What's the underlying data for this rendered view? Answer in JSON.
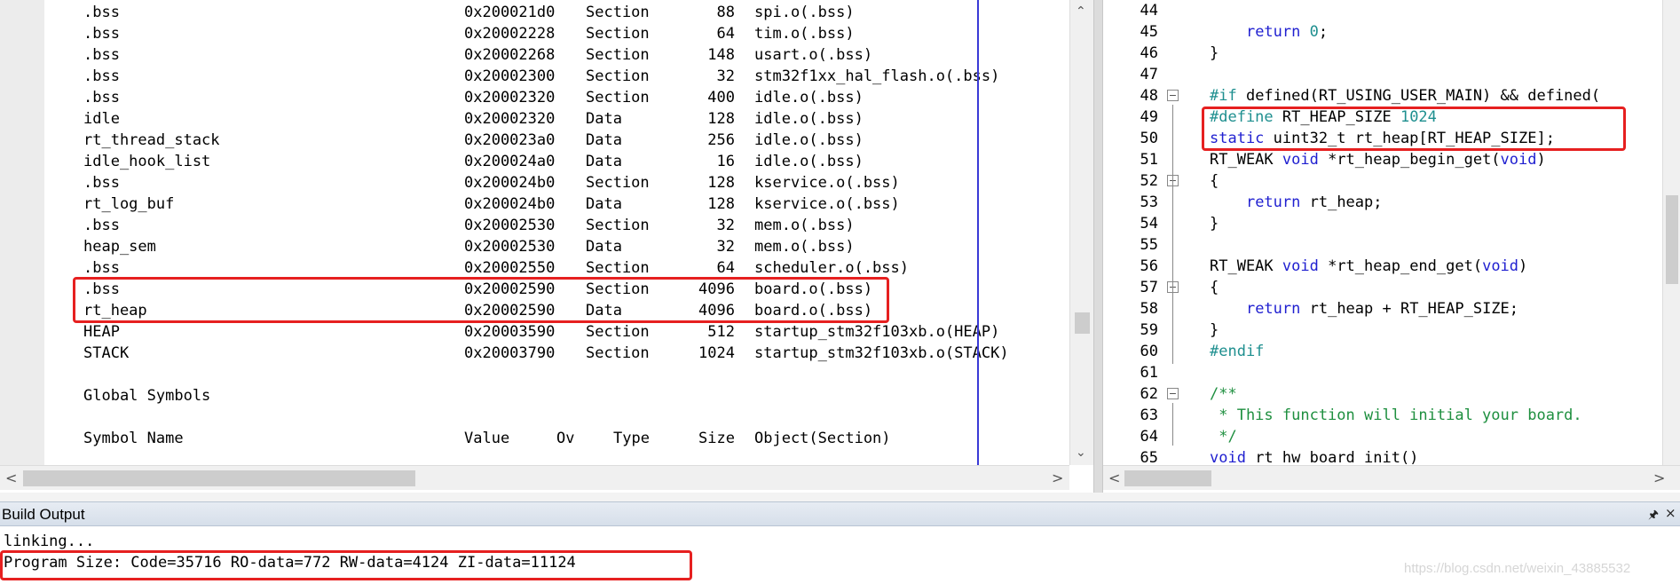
{
  "map_file": {
    "rows": [
      {
        "name": ".bss",
        "addr": "0x200021d0",
        "type": "Section",
        "size": "88",
        "obj": "spi.o(.bss)"
      },
      {
        "name": ".bss",
        "addr": "0x20002228",
        "type": "Section",
        "size": "64",
        "obj": "tim.o(.bss)"
      },
      {
        "name": ".bss",
        "addr": "0x20002268",
        "type": "Section",
        "size": "148",
        "obj": "usart.o(.bss)"
      },
      {
        "name": ".bss",
        "addr": "0x20002300",
        "type": "Section",
        "size": "32",
        "obj": "stm32f1xx_hal_flash.o(.bss)"
      },
      {
        "name": ".bss",
        "addr": "0x20002320",
        "type": "Section",
        "size": "400",
        "obj": "idle.o(.bss)"
      },
      {
        "name": "idle",
        "addr": "0x20002320",
        "type": "Data",
        "size": "128",
        "obj": "idle.o(.bss)"
      },
      {
        "name": "rt_thread_stack",
        "addr": "0x200023a0",
        "type": "Data",
        "size": "256",
        "obj": "idle.o(.bss)"
      },
      {
        "name": "idle_hook_list",
        "addr": "0x200024a0",
        "type": "Data",
        "size": "16",
        "obj": "idle.o(.bss)"
      },
      {
        "name": ".bss",
        "addr": "0x200024b0",
        "type": "Section",
        "size": "128",
        "obj": "kservice.o(.bss)"
      },
      {
        "name": "rt_log_buf",
        "addr": "0x200024b0",
        "type": "Data",
        "size": "128",
        "obj": "kservice.o(.bss)"
      },
      {
        "name": ".bss",
        "addr": "0x20002530",
        "type": "Section",
        "size": "32",
        "obj": "mem.o(.bss)"
      },
      {
        "name": "heap_sem",
        "addr": "0x20002530",
        "type": "Data",
        "size": "32",
        "obj": "mem.o(.bss)"
      },
      {
        "name": ".bss",
        "addr": "0x20002550",
        "type": "Section",
        "size": "64",
        "obj": "scheduler.o(.bss)"
      },
      {
        "name": ".bss",
        "addr": "0x20002590",
        "type": "Section",
        "size": "4096",
        "obj": "board.o(.bss)"
      },
      {
        "name": "rt_heap",
        "addr": "0x20002590",
        "type": "Data",
        "size": "4096",
        "obj": "board.o(.bss)"
      },
      {
        "name": "HEAP",
        "addr": "0x20003590",
        "type": "Section",
        "size": "512",
        "obj": "startup_stm32f103xb.o(HEAP)"
      },
      {
        "name": "STACK",
        "addr": "0x20003790",
        "type": "Section",
        "size": "1024",
        "obj": "startup_stm32f103xb.o(STACK)"
      }
    ],
    "global_symbols_heading": "Global Symbols",
    "header": {
      "name": "Symbol Name",
      "value": "Value",
      "ov": "Ov",
      "type": "Type",
      "size": "Size",
      "obj": "Object(Section)"
    }
  },
  "code_editor": {
    "lines": [
      {
        "num": "44",
        "fold": "",
        "tokens": []
      },
      {
        "num": "45",
        "fold": "",
        "tokens": [
          {
            "c": "tx",
            "t": "    "
          },
          {
            "c": "kw",
            "t": "return"
          },
          {
            "c": "tx",
            "t": " "
          },
          {
            "c": "num",
            "t": "0"
          },
          {
            "c": "tx",
            "t": ";"
          }
        ]
      },
      {
        "num": "46",
        "fold": "",
        "tokens": [
          {
            "c": "tx",
            "t": "}"
          }
        ]
      },
      {
        "num": "47",
        "fold": "",
        "tokens": []
      },
      {
        "num": "48",
        "fold": "−",
        "tokens": [
          {
            "c": "pp",
            "t": "#if"
          },
          {
            "c": "tx",
            "t": " defined(RT_USING_USER_MAIN) && defined("
          }
        ]
      },
      {
        "num": "49",
        "fold": "",
        "tokens": [
          {
            "c": "pp",
            "t": "#define"
          },
          {
            "c": "tx",
            "t": " RT_HEAP_SIZE "
          },
          {
            "c": "num",
            "t": "1024"
          }
        ]
      },
      {
        "num": "50",
        "fold": "",
        "tokens": [
          {
            "c": "kw",
            "t": "static"
          },
          {
            "c": "tx",
            "t": " uint32_t rt_heap[RT_HEAP_SIZE];"
          }
        ]
      },
      {
        "num": "51",
        "fold": "",
        "tokens": [
          {
            "c": "tx",
            "t": "RT_WEAK "
          },
          {
            "c": "kw",
            "t": "void"
          },
          {
            "c": "tx",
            "t": " *rt_heap_begin_get("
          },
          {
            "c": "kw",
            "t": "void"
          },
          {
            "c": "tx",
            "t": ")"
          }
        ]
      },
      {
        "num": "52",
        "fold": "−",
        "tokens": [
          {
            "c": "tx",
            "t": "{"
          }
        ]
      },
      {
        "num": "53",
        "fold": "",
        "tokens": [
          {
            "c": "tx",
            "t": "    "
          },
          {
            "c": "kw",
            "t": "return"
          },
          {
            "c": "tx",
            "t": " rt_heap;"
          }
        ]
      },
      {
        "num": "54",
        "fold": "",
        "tokens": [
          {
            "c": "tx",
            "t": "}"
          }
        ]
      },
      {
        "num": "55",
        "fold": "",
        "tokens": []
      },
      {
        "num": "56",
        "fold": "",
        "tokens": [
          {
            "c": "tx",
            "t": "RT_WEAK "
          },
          {
            "c": "kw",
            "t": "void"
          },
          {
            "c": "tx",
            "t": " *rt_heap_end_get("
          },
          {
            "c": "kw",
            "t": "void"
          },
          {
            "c": "tx",
            "t": ")"
          }
        ]
      },
      {
        "num": "57",
        "fold": "−",
        "tokens": [
          {
            "c": "tx",
            "t": "{"
          }
        ]
      },
      {
        "num": "58",
        "fold": "",
        "tokens": [
          {
            "c": "tx",
            "t": "    "
          },
          {
            "c": "kw",
            "t": "return"
          },
          {
            "c": "tx",
            "t": " rt_heap + RT_HEAP_SIZE;"
          }
        ]
      },
      {
        "num": "59",
        "fold": "",
        "tokens": [
          {
            "c": "tx",
            "t": "}"
          }
        ]
      },
      {
        "num": "60",
        "fold": "",
        "tokens": [
          {
            "c": "pp",
            "t": "#endif"
          }
        ]
      },
      {
        "num": "61",
        "fold": "",
        "tokens": []
      },
      {
        "num": "62",
        "fold": "−",
        "tokens": [
          {
            "c": "cm",
            "t": "/**"
          }
        ]
      },
      {
        "num": "63",
        "fold": "",
        "tokens": [
          {
            "c": "cm",
            "t": " * This function will initial your board."
          }
        ]
      },
      {
        "num": "64",
        "fold": "",
        "tokens": [
          {
            "c": "cm",
            "t": " */"
          }
        ]
      },
      {
        "num": "65",
        "fold": "",
        "tokens": [
          {
            "c": "kw",
            "t": "void"
          },
          {
            "c": "tx",
            "t": " rt_hw_board_init()"
          }
        ]
      }
    ]
  },
  "build_output": {
    "title": "Build Output",
    "lines": [
      "linking...",
      "Program Size: Code=35716 RO-data=772 RW-data=4124 ZI-data=11124"
    ]
  },
  "watermark": "https://blog.csdn.net/weixin_43885532",
  "icons": {
    "pin": "pin-icon",
    "close": "close-icon",
    "scroll_up": "chevron-up-icon",
    "scroll_down": "chevron-down-icon",
    "scroll_left": "chevron-left-icon",
    "scroll_right": "chevron-right-icon"
  },
  "colors": {
    "highlight": "#e62020",
    "keyword": "#1f1fd0",
    "preprocessor": "#1e8f8f",
    "comment": "#1e8f3f",
    "guide_line": "#3a3ad6"
  }
}
